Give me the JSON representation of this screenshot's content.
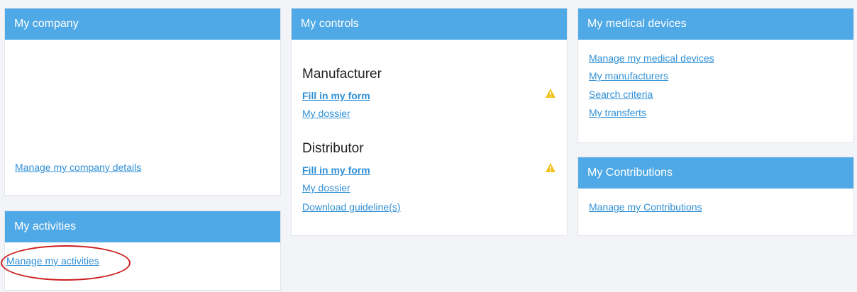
{
  "company": {
    "title": "My company",
    "manage_link": "Manage my company details"
  },
  "activities": {
    "title": "My activities",
    "manage_link": "Manage my activities"
  },
  "controls": {
    "title": "My controls",
    "manufacturer": {
      "heading": "Manufacturer",
      "fill_form": "Fill in my form",
      "dossier": "My dossier"
    },
    "distributor": {
      "heading": "Distributor",
      "fill_form": "Fill in my form",
      "dossier": "My dossier",
      "guidelines": "Download guideline(s)"
    }
  },
  "devices": {
    "title": "My medical devices",
    "links": {
      "manage": "Manage my medical devices",
      "manufacturers": "My manufacturers",
      "search": "Search criteria",
      "transfers": "My transferts"
    }
  },
  "contributions": {
    "title": "My Contributions",
    "manage_link": "Manage my Contributions"
  },
  "colors": {
    "header_bg": "#4fa9e6",
    "link": "#2f8fd6",
    "warning": "#f2c21a",
    "highlight": "#cc1e1e"
  },
  "icons": {
    "warning": "warning-icon"
  }
}
